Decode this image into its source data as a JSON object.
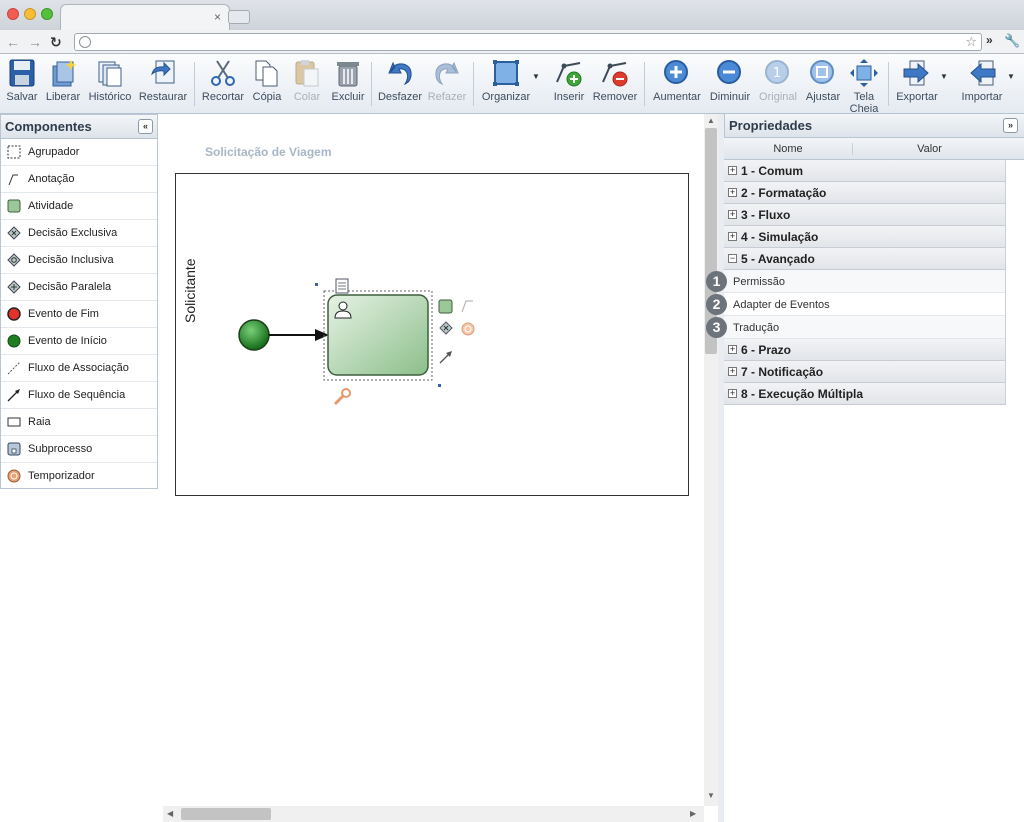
{
  "browser": {
    "tab_close": "×",
    "more": "»"
  },
  "toolbar": {
    "buttons": [
      {
        "label": "Salvar",
        "icon": "save-icon"
      },
      {
        "label": "Liberar",
        "icon": "release-icon"
      },
      {
        "label": "Histórico",
        "icon": "history-icon"
      },
      {
        "label": "Restaurar",
        "icon": "restore-icon"
      },
      {
        "label": "Recortar",
        "icon": "cut-icon"
      },
      {
        "label": "Cópia",
        "icon": "copy-icon"
      },
      {
        "label": "Colar",
        "icon": "paste-icon",
        "disabled": true
      },
      {
        "label": "Excluir",
        "icon": "delete-icon"
      },
      {
        "label": "Desfazer",
        "icon": "undo-icon"
      },
      {
        "label": "Refazer",
        "icon": "redo-icon",
        "disabled": true
      },
      {
        "label": "Organizar",
        "icon": "arrange-icon"
      },
      {
        "label": "Inserir",
        "icon": "insert-waypoint-icon"
      },
      {
        "label": "Remover",
        "icon": "remove-waypoint-icon"
      },
      {
        "label": "Aumentar",
        "icon": "zoom-in-icon"
      },
      {
        "label": "Diminuir",
        "icon": "zoom-out-icon"
      },
      {
        "label": "Original",
        "icon": "zoom-original-icon",
        "disabled": true
      },
      {
        "label": "Ajustar",
        "icon": "zoom-fit-icon"
      },
      {
        "label": "Tela Cheia",
        "icon": "fullscreen-icon"
      },
      {
        "label": "Exportar",
        "icon": "export-icon"
      },
      {
        "label": "Importar",
        "icon": "import-icon"
      }
    ]
  },
  "components": {
    "title": "Componentes",
    "collapse": "«",
    "items": [
      {
        "label": "Agrupador",
        "icon": "group-icon"
      },
      {
        "label": "Anotação",
        "icon": "annotation-icon"
      },
      {
        "label": "Atividade",
        "icon": "activity-icon"
      },
      {
        "label": "Decisão Exclusiva",
        "icon": "exclusive-gateway-icon"
      },
      {
        "label": "Decisão Inclusiva",
        "icon": "inclusive-gateway-icon"
      },
      {
        "label": "Decisão Paralela",
        "icon": "parallel-gateway-icon"
      },
      {
        "label": "Evento de Fim",
        "icon": "end-event-icon"
      },
      {
        "label": "Evento de Início",
        "icon": "start-event-icon"
      },
      {
        "label": "Fluxo de Associação",
        "icon": "association-flow-icon"
      },
      {
        "label": "Fluxo de Sequência",
        "icon": "sequence-flow-icon"
      },
      {
        "label": "Raia",
        "icon": "lane-icon"
      },
      {
        "label": "Subprocesso",
        "icon": "subprocess-icon"
      },
      {
        "label": "Temporizador",
        "icon": "timer-icon"
      }
    ]
  },
  "diagram": {
    "title": "Solicitação de Viagem",
    "lane": "Solicitante"
  },
  "properties": {
    "title": "Propriedades",
    "expand": "»",
    "col_name": "Nome",
    "col_value": "Valor",
    "groups_before": [
      {
        "label": "1 - Comum",
        "expander": "+"
      },
      {
        "label": "2 - Formatação",
        "expander": "+"
      },
      {
        "label": "3 - Fluxo",
        "expander": "+"
      },
      {
        "label": "4 - Simulação",
        "expander": "+"
      },
      {
        "label": "5 - Avançado",
        "expander": "−"
      }
    ],
    "advanced_rows": [
      {
        "badge": "1",
        "label": "Permissão"
      },
      {
        "badge": "2",
        "label": "Adapter de Eventos"
      },
      {
        "badge": "3",
        "label": "Tradução"
      }
    ],
    "groups_after": [
      {
        "label": "6 - Prazo",
        "expander": "+"
      },
      {
        "label": "7 - Notificação",
        "expander": "+"
      },
      {
        "label": "8 - Execução Múltipla",
        "expander": "+"
      }
    ]
  }
}
